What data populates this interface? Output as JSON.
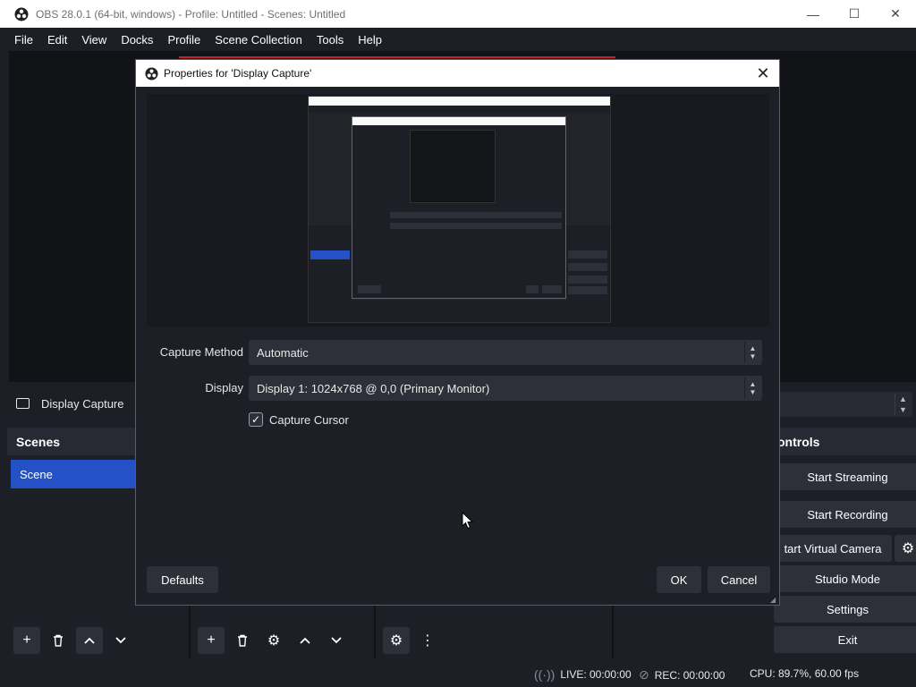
{
  "window": {
    "title": "OBS 28.0.1 (64-bit, windows) - Profile: Untitled - Scenes: Untitled",
    "minimize": "—",
    "maximize": "☐",
    "close": "✕"
  },
  "menu": [
    "File",
    "Edit",
    "View",
    "Docks",
    "Profile",
    "Scene Collection",
    "Tools",
    "Help"
  ],
  "source_bar": {
    "source_name": "Display Capture"
  },
  "scenes": {
    "header": "Scenes",
    "items": [
      "Scene"
    ]
  },
  "controls": {
    "header": "Controls",
    "header_visible": "ontrols",
    "start_streaming": "Start Streaming",
    "start_recording": "Start Recording",
    "start_virtual_camera": "tart Virtual Camera",
    "studio_mode": "Studio Mode",
    "settings": "Settings",
    "exit": "Exit"
  },
  "status": {
    "live": "LIVE: 00:00:00",
    "rec": "REC: 00:00:00",
    "cpu": "CPU: 89.7%, 60.00 fps"
  },
  "dialog": {
    "title": "Properties for 'Display Capture'",
    "capture_method_label": "Capture Method",
    "capture_method_value": "Automatic",
    "display_label": "Display",
    "display_value": "Display 1: 1024x768 @ 0,0 (Primary Monitor)",
    "capture_cursor_label": "Capture Cursor",
    "capture_cursor_checked": true,
    "defaults_button": "Defaults",
    "ok_button": "OK",
    "cancel_button": "Cancel"
  },
  "colors": {
    "background": "#1d1f26",
    "panel": "#272a33",
    "button": "#2d3039",
    "selected": "#2451c5",
    "preview_border": "#cc2020"
  },
  "icons": {
    "app": "obs-logo-icon",
    "add": "plus-icon",
    "remove": "trash-icon",
    "up": "chevron-up-icon",
    "down": "chevron-down-icon",
    "filters": "gear-icon",
    "mixer_settings": "gear-icon",
    "more": "kebab-menu-icon"
  }
}
